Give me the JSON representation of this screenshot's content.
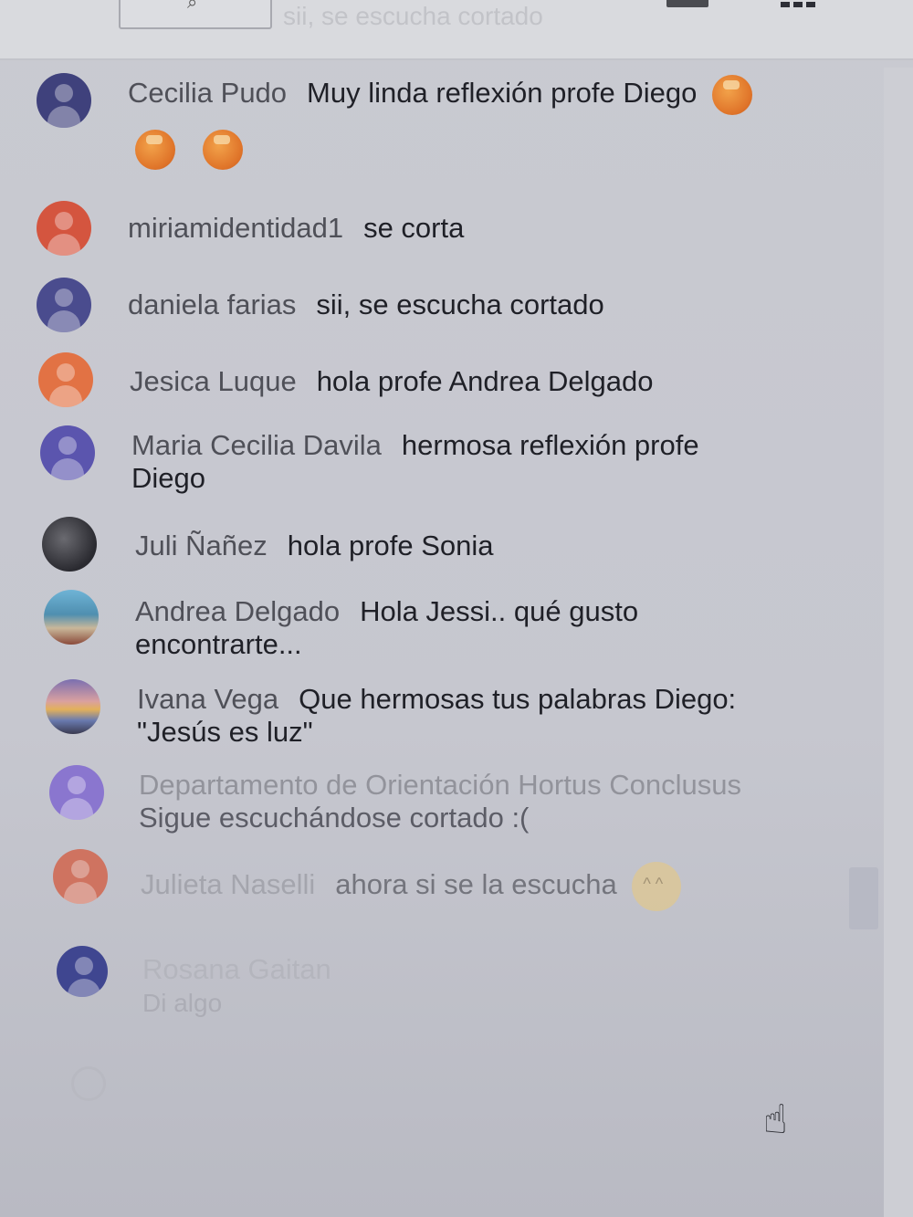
{
  "topbar": {
    "faded_text": "sii, se escucha cortado"
  },
  "colors": {
    "background": "#c6c7cf",
    "author_text": "#4f5058",
    "message_text": "#1f2027",
    "avatar_purple": "#4a4b8a",
    "avatar_red": "#d55a45",
    "avatar_orange": "#e27644",
    "avatar_violet": "#7d6fc4"
  },
  "messages": [
    {
      "author": "Cecilia Pudo",
      "text": "Muy linda reflexión profe Diego",
      "avatar_icon": "person-avatar-icon",
      "avatar_color": "#3f417c",
      "emojis": [
        "clapping-hands-emoji",
        "clapping-hands-emoji",
        "clapping-hands-emoji"
      ]
    },
    {
      "author": "miriamidentidad1",
      "text": "se corta",
      "avatar_icon": "person-avatar-icon",
      "avatar_color": "#d4553f"
    },
    {
      "author": "daniela farias",
      "text": "sii, se escucha cortado",
      "avatar_icon": "person-avatar-icon",
      "avatar_color": "#4a4c8e"
    },
    {
      "author": "Jesica Luque",
      "text": "hola profe Andrea Delgado",
      "avatar_icon": "person-avatar-icon",
      "avatar_color": "#e27244"
    },
    {
      "author": "Maria Cecilia Davila",
      "text": "hermosa reflexión profe Diego",
      "avatar_icon": "person-avatar-icon",
      "avatar_color": "#5b55ae"
    },
    {
      "author": "Juli Ñañez",
      "text": "hola profe Sonia",
      "avatar_icon": "photo-avatar-icon",
      "avatar_color": "#3a3a40"
    },
    {
      "author": "Andrea Delgado",
      "text": "Hola Jessi.. qué gusto encontrarte...",
      "avatar_icon": "photo-avatar-icon",
      "avatar_color": "#4f8fb0"
    },
    {
      "author": "Ivana Vega",
      "text": "Que hermosas tus palabras Diego: \"Jesús es luz\"",
      "avatar_icon": "photo-avatar-icon",
      "avatar_color": "#b06a6a"
    },
    {
      "author": "Departamento de Orientación Hortus Conclusus",
      "text": "Sigue escuchándose cortado :(",
      "avatar_icon": "person-avatar-icon",
      "avatar_color": "#8a76cf"
    },
    {
      "author": "Julieta Naselli",
      "text": "ahora si se la escucha",
      "avatar_icon": "person-avatar-icon",
      "avatar_color": "#d2664e",
      "emojis": [
        "smiling-face-emoji"
      ]
    },
    {
      "author": "Rosana Gaitan",
      "text": "Di algo",
      "avatar_icon": "person-avatar-icon",
      "avatar_color": "#3f4690"
    }
  ]
}
